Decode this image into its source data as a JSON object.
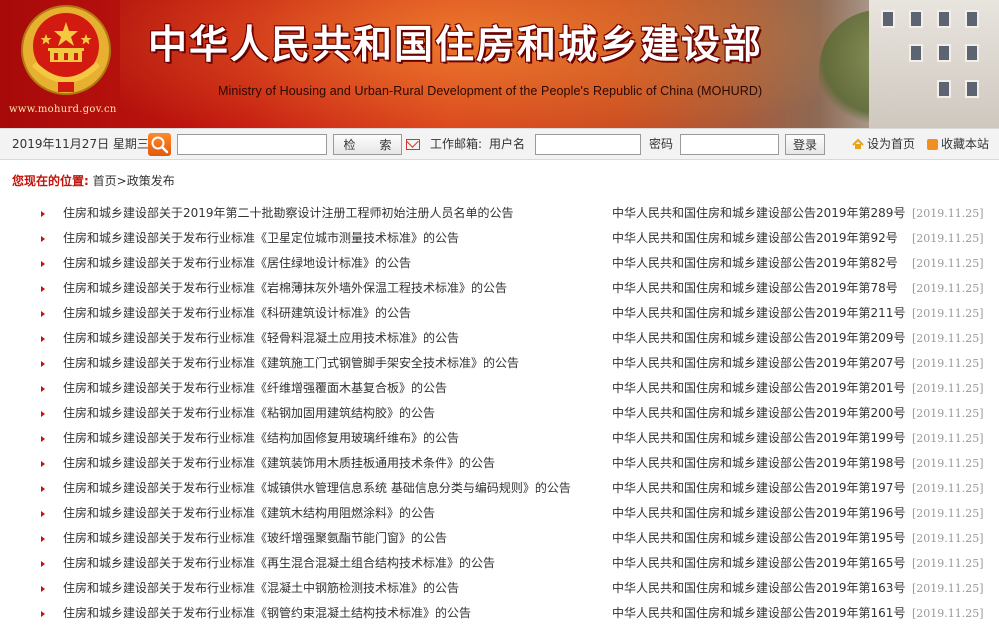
{
  "header": {
    "title_cn": "中华人民共和国住房和城乡建设部",
    "title_en": "Ministry of Housing and Urban-Rural Development of the People's Republic of China (MOHURD)",
    "site_url": "www.mohurd.gov.cn",
    "emblem_icon": "national-emblem-icon",
    "colors": {
      "banner_red": "#c4170f",
      "title_text": "#ffffff"
    }
  },
  "toolbar": {
    "date": "2019年11月27日 星期三",
    "search_value": "",
    "search_button": "检　　索",
    "mail_label": "工作邮箱:",
    "username_label": "用户名",
    "username_value": "",
    "password_label": "密码",
    "password_value": "",
    "login_button": "登录",
    "set_home": "设为首页",
    "bookmark": "收藏本站"
  },
  "breadcrumb": {
    "label": "您现在的位置:",
    "path": "首页>政策发布"
  },
  "list": [
    {
      "title": "住房和城乡建设部关于2019年第二十批勘察设计注册工程师初始注册人员名单的公告",
      "doc": "中华人民共和国住房和城乡建设部公告2019年第289号",
      "date": "[2019.11.25]"
    },
    {
      "title": "住房和城乡建设部关于发布行业标准《卫星定位城市测量技术标准》的公告",
      "doc": "中华人民共和国住房和城乡建设部公告2019年第92号",
      "date": "[2019.11.25]"
    },
    {
      "title": "住房和城乡建设部关于发布行业标准《居住绿地设计标准》的公告",
      "doc": "中华人民共和国住房和城乡建设部公告2019年第82号",
      "date": "[2019.11.25]"
    },
    {
      "title": "住房和城乡建设部关于发布行业标准《岩棉薄抹灰外墙外保温工程技术标准》的公告",
      "doc": "中华人民共和国住房和城乡建设部公告2019年第78号",
      "date": "[2019.11.25]"
    },
    {
      "title": "住房和城乡建设部关于发布行业标准《科研建筑设计标准》的公告",
      "doc": "中华人民共和国住房和城乡建设部公告2019年第211号",
      "date": "[2019.11.25]"
    },
    {
      "title": "住房和城乡建设部关于发布行业标准《轻骨料混凝土应用技术标准》的公告",
      "doc": "中华人民共和国住房和城乡建设部公告2019年第209号",
      "date": "[2019.11.25]"
    },
    {
      "title": "住房和城乡建设部关于发布行业标准《建筑施工门式钢管脚手架安全技术标准》的公告",
      "doc": "中华人民共和国住房和城乡建设部公告2019年第207号",
      "date": "[2019.11.25]"
    },
    {
      "title": "住房和城乡建设部关于发布行业标准《纤维增强覆面木基复合板》的公告",
      "doc": "中华人民共和国住房和城乡建设部公告2019年第201号",
      "date": "[2019.11.25]"
    },
    {
      "title": "住房和城乡建设部关于发布行业标准《粘钢加固用建筑结构胶》的公告",
      "doc": "中华人民共和国住房和城乡建设部公告2019年第200号",
      "date": "[2019.11.25]"
    },
    {
      "title": "住房和城乡建设部关于发布行业标准《结构加固修复用玻璃纤维布》的公告",
      "doc": "中华人民共和国住房和城乡建设部公告2019年第199号",
      "date": "[2019.11.25]"
    },
    {
      "title": "住房和城乡建设部关于发布行业标准《建筑装饰用木质挂板通用技术条件》的公告",
      "doc": "中华人民共和国住房和城乡建设部公告2019年第198号",
      "date": "[2019.11.25]"
    },
    {
      "title": "住房和城乡建设部关于发布行业标准《城镇供水管理信息系统 基础信息分类与编码规则》的公告",
      "doc": "中华人民共和国住房和城乡建设部公告2019年第197号",
      "date": "[2019.11.25]"
    },
    {
      "title": "住房和城乡建设部关于发布行业标准《建筑木结构用阻燃涂料》的公告",
      "doc": "中华人民共和国住房和城乡建设部公告2019年第196号",
      "date": "[2019.11.25]"
    },
    {
      "title": "住房和城乡建设部关于发布行业标准《玻纤增强聚氨酯节能门窗》的公告",
      "doc": "中华人民共和国住房和城乡建设部公告2019年第195号",
      "date": "[2019.11.25]"
    },
    {
      "title": "住房和城乡建设部关于发布行业标准《再生混合混凝土组合结构技术标准》的公告",
      "doc": "中华人民共和国住房和城乡建设部公告2019年第165号",
      "date": "[2019.11.25]"
    },
    {
      "title": "住房和城乡建设部关于发布行业标准《混凝土中钢筋检测技术标准》的公告",
      "doc": "中华人民共和国住房和城乡建设部公告2019年第163号",
      "date": "[2019.11.25]"
    },
    {
      "title": "住房和城乡建设部关于发布行业标准《钢管约束混凝土结构技术标准》的公告",
      "doc": "中华人民共和国住房和城乡建设部公告2019年第161号",
      "date": "[2019.11.25]"
    }
  ]
}
